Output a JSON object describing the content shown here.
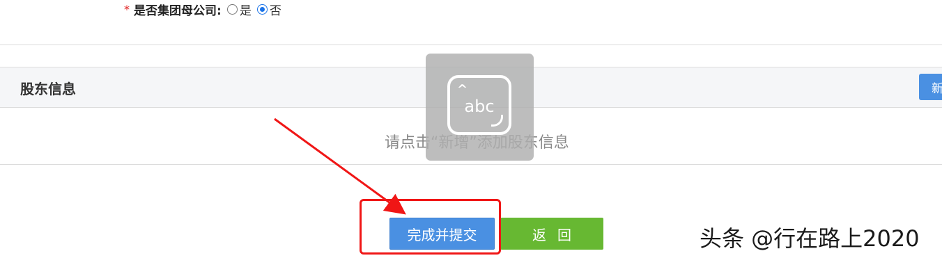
{
  "form": {
    "required_mark": "*",
    "label": "是否集团母公司:",
    "options": [
      {
        "label": "是",
        "checked": false
      },
      {
        "label": "否",
        "checked": true
      }
    ]
  },
  "section": {
    "title": "股东信息",
    "add_button": "新增"
  },
  "empty_state": {
    "text": "请点击“新增”添加股东信息"
  },
  "ime_indicator": {
    "label": "abc"
  },
  "actions": {
    "submit_label": "完成并提交",
    "back_label": "返回"
  },
  "watermark": {
    "text": "头条 @行在路上2020"
  },
  "colors": {
    "primary": "#4a90e2",
    "back": "#67b832",
    "annotation": "#f01616",
    "required": "#e02020"
  }
}
